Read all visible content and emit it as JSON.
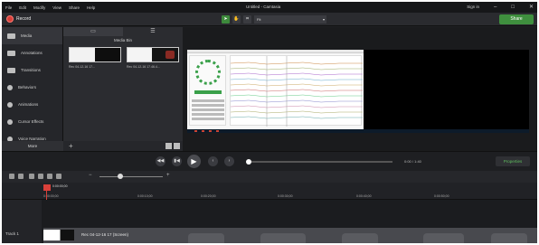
{
  "menu": [
    "File",
    "Edit",
    "Modify",
    "View",
    "Share",
    "Help"
  ],
  "window_title": "Untitled - Camtasia",
  "window_controls": {
    "signin": "Sign in",
    "minimize": "–",
    "maximize": "□",
    "close": "✕"
  },
  "toolbar": {
    "record_label": "Record",
    "zoom_value": "Fit",
    "share_label": "Share"
  },
  "sidebar": {
    "items": [
      {
        "label": "Media",
        "icon": "media-icon"
      },
      {
        "label": "Annotations",
        "icon": "annotations-icon"
      },
      {
        "label": "Transitions",
        "icon": "transitions-icon"
      },
      {
        "label": "Behaviors",
        "icon": "behaviors-icon"
      },
      {
        "label": "Animations",
        "icon": "animations-icon"
      },
      {
        "label": "Cursor Effects",
        "icon": "cursor-effects-icon"
      },
      {
        "label": "Voice Narration",
        "icon": "microphone-icon"
      }
    ],
    "more_label": "More"
  },
  "media_bin": {
    "title": "Media Bin",
    "items": [
      {
        "label": "Rec 04-12-16 17..."
      },
      {
        "label": "Rec 04-12-16 17.46.4..."
      }
    ]
  },
  "transport": {
    "timecode": "0:00 / 1:40",
    "properties_label": "Properties"
  },
  "timeline": {
    "playhead_time": "0:00:00;00",
    "ticks": [
      "0:00:00;00",
      "0:00:10;00",
      "0:00:20;00",
      "0:00:30;00",
      "0:00:40;00",
      "0:00:50;00"
    ],
    "track_name": "Track 1",
    "clip_label": "Rec 04-12-16 17 (Screen)"
  }
}
